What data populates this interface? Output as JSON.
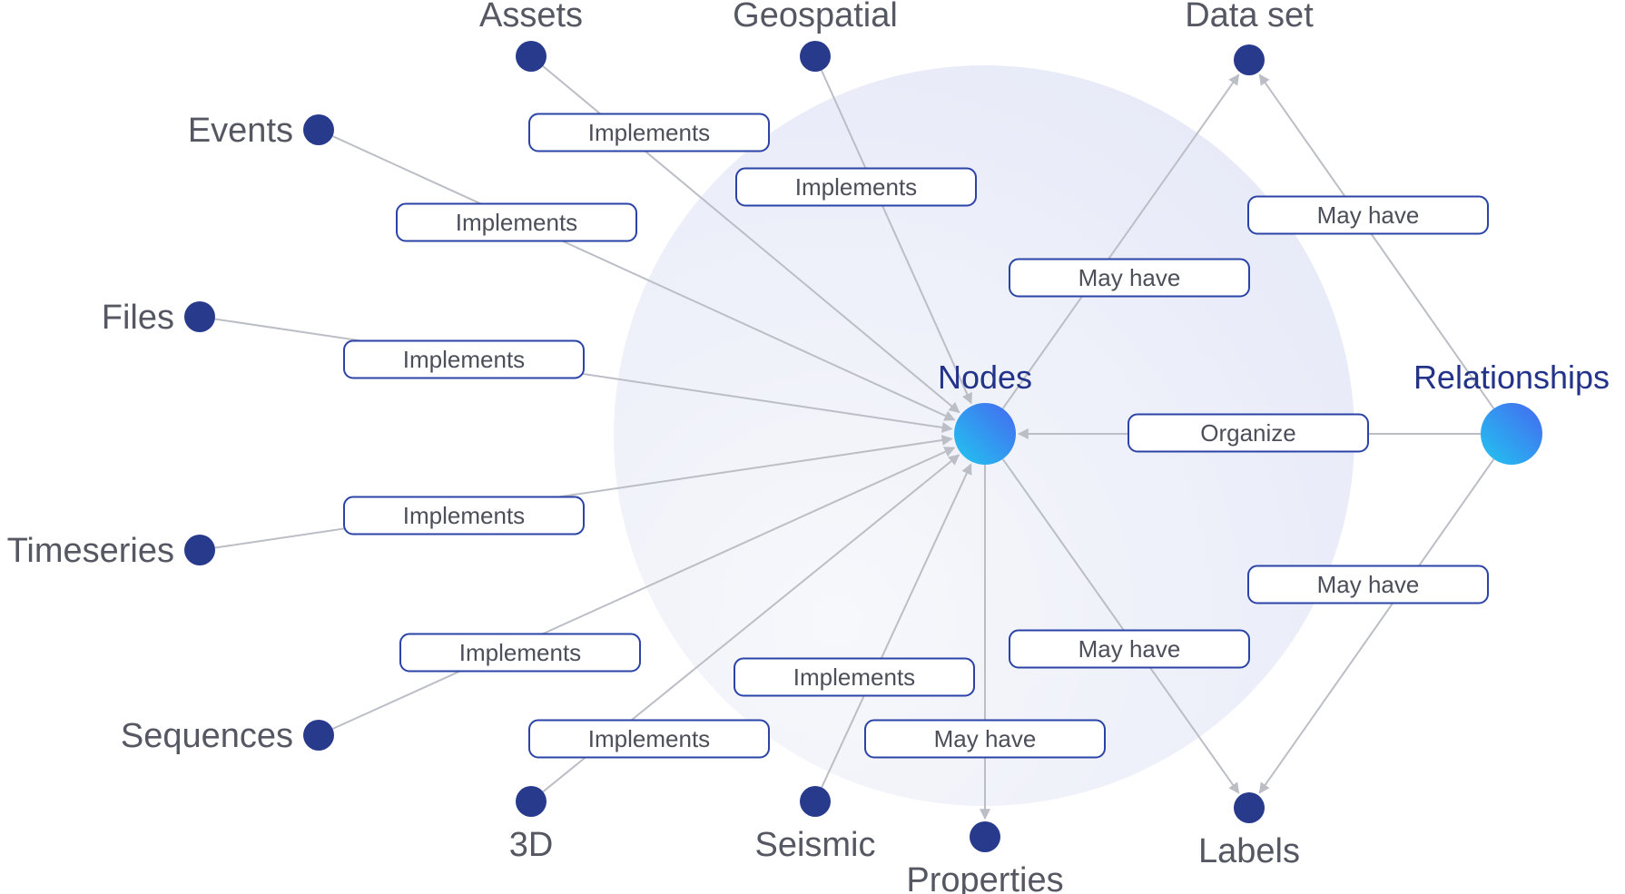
{
  "colors": {
    "leaf_dot": "#283a8c",
    "hub_gradient_start": "#22c6ef",
    "hub_gradient_end": "#4568f1",
    "hub_label": "#24338a",
    "leaf_label": "#555862",
    "edge_line": "#bcbec6",
    "label_border": "#2b43a6",
    "background_circle_start": "#f6f7fb",
    "background_circle_end": "#e8ebf8"
  },
  "hubs": [
    {
      "id": "nodes",
      "label": "Nodes"
    },
    {
      "id": "relationships",
      "label": "Relationships"
    }
  ],
  "leaves": [
    {
      "id": "assets",
      "label": "Assets"
    },
    {
      "id": "geospatial",
      "label": "Geospatial"
    },
    {
      "id": "dataset",
      "label": "Data set"
    },
    {
      "id": "events",
      "label": "Events"
    },
    {
      "id": "files",
      "label": "Files"
    },
    {
      "id": "timeseries",
      "label": "Timeseries"
    },
    {
      "id": "sequences",
      "label": "Sequences"
    },
    {
      "id": "3d",
      "label": "3D"
    },
    {
      "id": "seismic",
      "label": "Seismic"
    },
    {
      "id": "properties",
      "label": "Properties"
    },
    {
      "id": "labels",
      "label": "Labels"
    }
  ],
  "edges": [
    {
      "from": "assets",
      "to": "nodes",
      "label": "Implements"
    },
    {
      "from": "geospatial",
      "to": "nodes",
      "label": "Implements"
    },
    {
      "from": "events",
      "to": "nodes",
      "label": "Implements"
    },
    {
      "from": "files",
      "to": "nodes",
      "label": "Implements"
    },
    {
      "from": "timeseries",
      "to": "nodes",
      "label": "Implements"
    },
    {
      "from": "sequences",
      "to": "nodes",
      "label": "Implements"
    },
    {
      "from": "3d",
      "to": "nodes",
      "label": "Implements"
    },
    {
      "from": "seismic",
      "to": "nodes",
      "label": "Implements"
    },
    {
      "from": "nodes",
      "to": "properties",
      "label": "May have"
    },
    {
      "from": "nodes",
      "to": "dataset",
      "label": "May have"
    },
    {
      "from": "nodes",
      "to": "labels",
      "label": "May have"
    },
    {
      "from": "relationships",
      "to": "nodes",
      "label": "Organize"
    },
    {
      "from": "relationships",
      "to": "dataset",
      "label": "May have"
    },
    {
      "from": "relationships",
      "to": "labels",
      "label": "May have"
    }
  ]
}
